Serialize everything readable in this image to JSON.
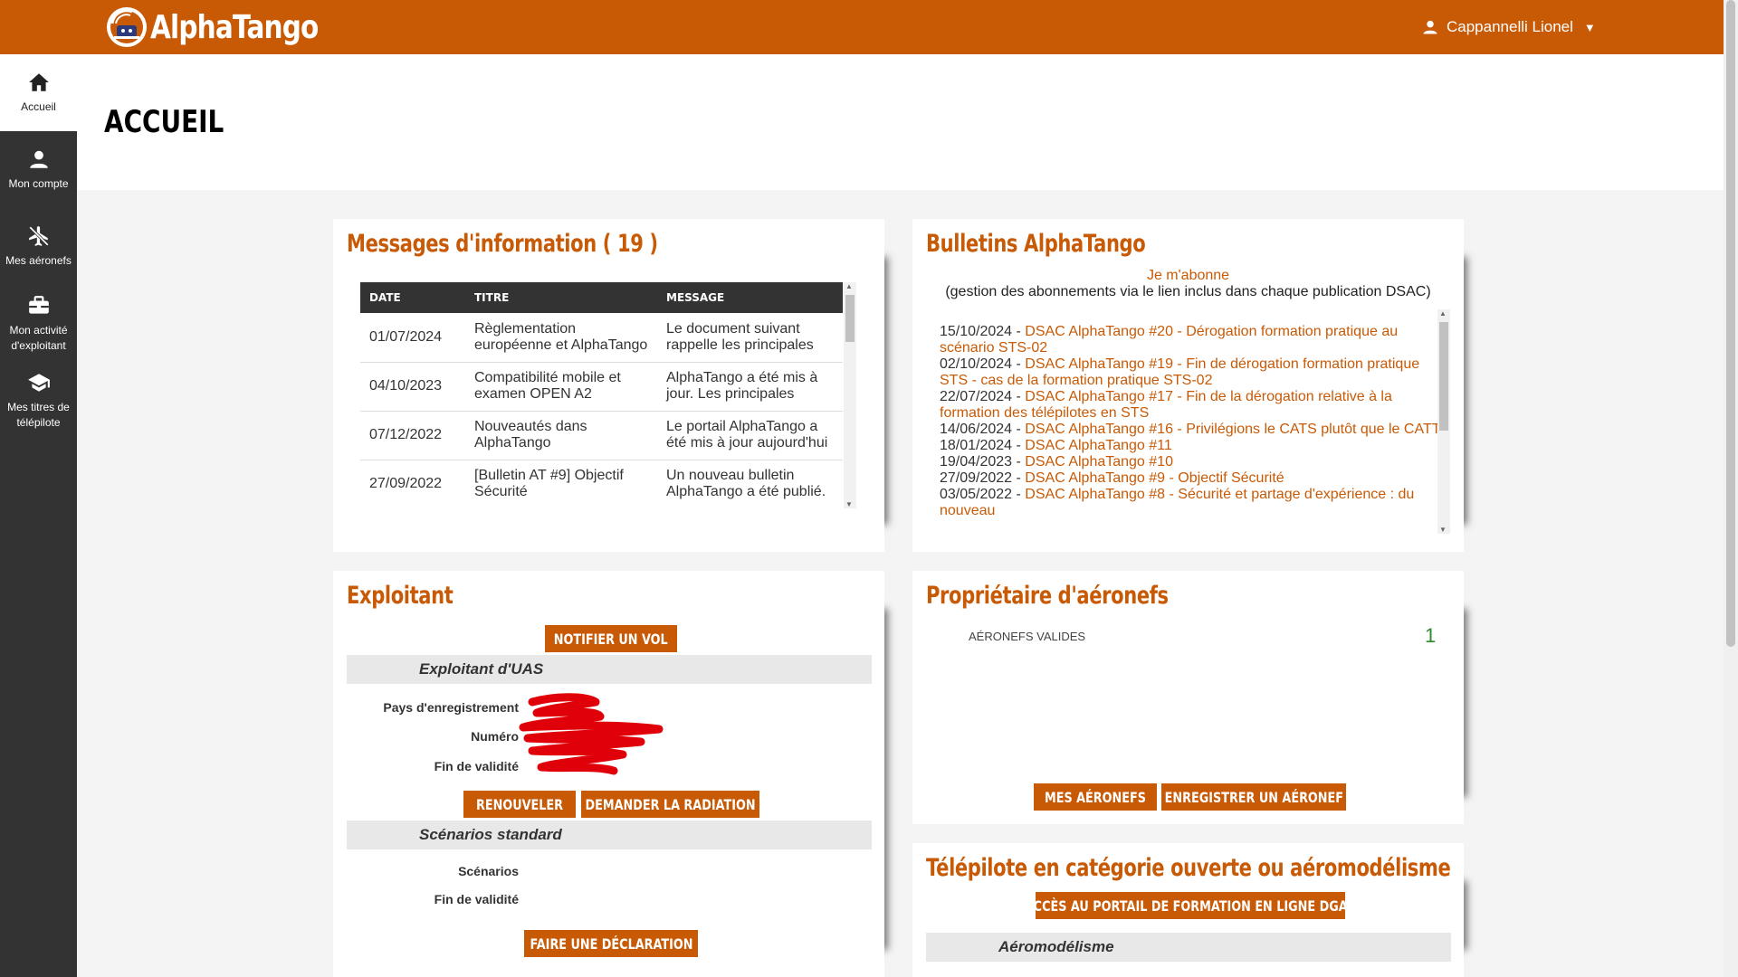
{
  "app": {
    "name": "AlphaTango"
  },
  "user": {
    "name": "Cappannelli Lionel"
  },
  "sidebar": {
    "items": [
      {
        "label": "Accueil"
      },
      {
        "label": "Mon compte"
      },
      {
        "label": "Mes aéronefs"
      },
      {
        "label": "Mon activité d'exploitant"
      },
      {
        "label": "Mes titres de télépilote"
      }
    ]
  },
  "page": {
    "title": "ACCUEIL"
  },
  "messages": {
    "title": "Messages d'information ( 19 )",
    "columns": [
      "DATE",
      "TITRE",
      "MESSAGE"
    ],
    "rows": [
      {
        "date": "01/07/2024",
        "title": "Règlementation européenne et AlphaTango",
        "message": "Le document suivant rappelle les principales"
      },
      {
        "date": "04/10/2023",
        "title": "Compatibilité mobile et examen OPEN A2",
        "message": "AlphaTango a été mis à jour. Les principales"
      },
      {
        "date": "07/12/2022",
        "title": "Nouveautés dans AlphaTango",
        "message": "Le portail AlphaTango a été mis à jour aujourd'hui"
      },
      {
        "date": "27/09/2022",
        "title": "[Bulletin AT #9] Objectif Sécurité",
        "message": "Un nouveau bulletin AlphaTango a été publié."
      }
    ]
  },
  "bulletins": {
    "title": "Bulletins AlphaTango",
    "subscribe_link": "Je m'abonne",
    "subscribe_note": "(gestion des abonnements via le lien inclus dans chaque publication DSAC)",
    "items": [
      {
        "date": "15/10/2024",
        "title": "DSAC AlphaTango #20 - Dérogation formation pratique au scénario STS-02"
      },
      {
        "date": "02/10/2024",
        "title": "DSAC AlphaTango #19 - Fin de dérogation formation pratique STS - cas de la formation pratique STS-02"
      },
      {
        "date": "22/07/2024",
        "title": "DSAC AlphaTango #17 - Fin de la dérogation relative à la formation des télépilotes en STS"
      },
      {
        "date": "14/06/2024",
        "title": "DSAC AlphaTango #16 - Privilégions le CATS plutôt que le CATT"
      },
      {
        "date": "18/01/2024",
        "title": "DSAC AlphaTango #11"
      },
      {
        "date": "19/04/2023",
        "title": "DSAC AlphaTango #10"
      },
      {
        "date": "27/09/2022",
        "title": "DSAC AlphaTango #9 - Objectif Sécurité"
      },
      {
        "date": "03/05/2022",
        "title": "DSAC AlphaTango #8 - Sécurité et partage d'expérience : du nouveau"
      }
    ]
  },
  "exploitant": {
    "title": "Exploitant",
    "notify_button": "NOTIFIER UN VOL",
    "uas_section": "Exploitant d'UAS",
    "fields": [
      "Pays d'enregistrement",
      "Numéro",
      "Fin de validité"
    ],
    "renew_button": "RENOUVELER",
    "radiation_button": "DEMANDER LA RADIATION",
    "scenarios_section": "Scénarios standard",
    "scenario_fields": [
      "Scénarios",
      "Fin de validité"
    ],
    "declare_button": "FAIRE UNE DÉCLARATION"
  },
  "proprietaire": {
    "title": "Propriétaire d'aéronefs",
    "valid_label": "AÉRONEFS VALIDES",
    "valid_count": "1",
    "my_button": "MES AÉRONEFS",
    "register_button": "ENREGISTRER UN AÉRONEF"
  },
  "telepilote": {
    "title": "Télépilote en catégorie ouverte ou aéromodélisme",
    "training_button": "ACCÈS AU PORTAIL DE FORMATION EN LIGNE DGAC",
    "section": "Aéromodélisme"
  },
  "colors": {
    "brand": "#c85a06",
    "sidebar": "#333333",
    "redaction": "#e0000a",
    "count": "#2e8b2e"
  }
}
